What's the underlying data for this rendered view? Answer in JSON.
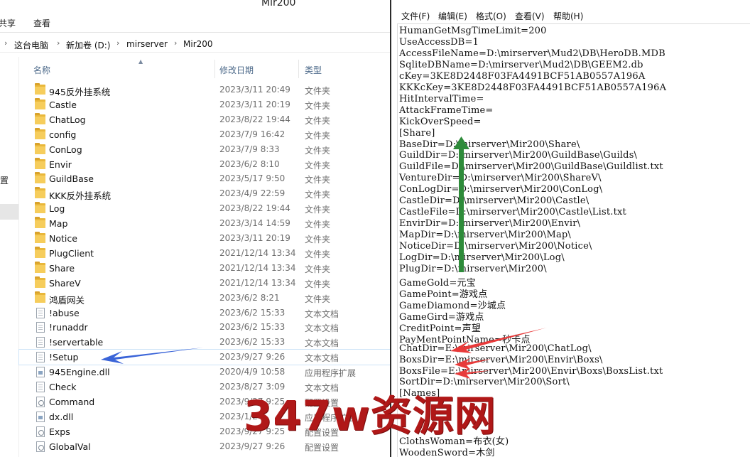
{
  "explorer": {
    "window_title": "Mir200",
    "ribbon": {
      "share_tab": "共享",
      "view_tab": "查看"
    },
    "breadcrumb": [
      "这台电脑",
      "新加卷 (D:)",
      "mirserver",
      "Mir200"
    ],
    "nav_label": "置",
    "columns": {
      "name": "名称",
      "date": "修改日期",
      "type": "类型"
    },
    "files": [
      {
        "name": "945反外挂系统",
        "date": "2023/3/11 20:49",
        "type": "文件夹",
        "icon": "folder-icon"
      },
      {
        "name": "Castle",
        "date": "2023/3/11 20:19",
        "type": "文件夹",
        "icon": "folder-icon"
      },
      {
        "name": "ChatLog",
        "date": "2023/8/22 19:44",
        "type": "文件夹",
        "icon": "folder-icon"
      },
      {
        "name": "config",
        "date": "2023/7/9 16:42",
        "type": "文件夹",
        "icon": "folder-icon"
      },
      {
        "name": "ConLog",
        "date": "2023/7/9 8:33",
        "type": "文件夹",
        "icon": "folder-icon"
      },
      {
        "name": "Envir",
        "date": "2023/6/2 8:10",
        "type": "文件夹",
        "icon": "folder-icon"
      },
      {
        "name": "GuildBase",
        "date": "2023/5/17 9:50",
        "type": "文件夹",
        "icon": "folder-icon"
      },
      {
        "name": "KKK反外挂系统",
        "date": "2023/4/9 22:59",
        "type": "文件夹",
        "icon": "folder-icon"
      },
      {
        "name": "Log",
        "date": "2023/8/22 19:44",
        "type": "文件夹",
        "icon": "folder-icon"
      },
      {
        "name": "Map",
        "date": "2023/3/14 14:59",
        "type": "文件夹",
        "icon": "folder-icon"
      },
      {
        "name": "Notice",
        "date": "2023/3/11 20:19",
        "type": "文件夹",
        "icon": "folder-icon"
      },
      {
        "name": "PlugClient",
        "date": "2021/12/14 13:34",
        "type": "文件夹",
        "icon": "folder-icon"
      },
      {
        "name": "Share",
        "date": "2021/12/14 13:34",
        "type": "文件夹",
        "icon": "folder-icon"
      },
      {
        "name": "ShareV",
        "date": "2021/12/14 13:34",
        "type": "文件夹",
        "icon": "folder-icon"
      },
      {
        "name": "鸿盾网关",
        "date": "2023/6/2 8:21",
        "type": "文件夹",
        "icon": "folder-icon"
      },
      {
        "name": "!abuse",
        "date": "2023/6/2 15:33",
        "type": "文本文档",
        "icon": "text-document-icon"
      },
      {
        "name": "!runaddr",
        "date": "2023/6/2 15:33",
        "type": "文本文档",
        "icon": "text-document-icon"
      },
      {
        "name": "!servertable",
        "date": "2023/6/2 15:33",
        "type": "文本文档",
        "icon": "text-document-icon"
      },
      {
        "name": "!Setup",
        "date": "2023/9/27 9:26",
        "type": "文本文档",
        "icon": "text-document-icon",
        "selected": true
      },
      {
        "name": "945Engine.dll",
        "date": "2020/4/9 10:58",
        "type": "应用程序扩展",
        "icon": "dll-icon"
      },
      {
        "name": "Check",
        "date": "2023/8/27 3:09",
        "type": "文本文档",
        "icon": "text-document-icon"
      },
      {
        "name": "Command",
        "date": "2023/9/27 9:25",
        "type": "配置设置",
        "icon": "config-file-icon"
      },
      {
        "name": "dx.dll",
        "date": "2023/1/2",
        "type": "应用程序扩展",
        "icon": "dll-icon"
      },
      {
        "name": "Exps",
        "date": "2023/9/27 9:25",
        "type": "配置设置",
        "icon": "config-file-icon"
      },
      {
        "name": "GlobalVal",
        "date": "2023/9/27 9:26",
        "type": "配置设置",
        "icon": "config-file-icon"
      }
    ]
  },
  "notepad": {
    "menu": [
      "文件(F)",
      "编辑(E)",
      "格式(O)",
      "查看(V)",
      "帮助(H)"
    ],
    "lines": [
      "HumanGetMsgTimeLimit=200",
      "UseAccessDB=1",
      "AccessFileName=D:\\mirserver\\Mud2\\DB\\HeroDB.MDB",
      "SqliteDBName=D:\\mirserver\\Mud2\\DB\\GEEM2.db",
      "cKey=3KE8D2448F03FA4491BCF51AB0557A196A",
      "KKKcKey=3KE8D2448F03FA4491BCF51AB0557A196A",
      "HitIntervalTime=",
      "AttackFrameTime=",
      "KickOverSpeed=",
      "[Share]",
      "BaseDir=D:\\mirserver\\Mir200\\Share\\",
      "GuildDir=D:\\mirserver\\Mir200\\GuildBase\\Guilds\\",
      "GuildFile=D:\\mirserver\\Mir200\\GuildBase\\Guildlist.txt",
      "VentureDir=D:\\mirserver\\Mir200\\ShareV\\",
      "ConLogDir=D:\\mirserver\\Mir200\\ConLog\\",
      "CastleDir=D:\\mirserver\\Mir200\\Castle\\",
      "CastleFile=D:\\mirserver\\Mir200\\Castle\\List.txt",
      "EnvirDir=D:\\mirserver\\Mir200\\Envir\\",
      "MapDir=D:\\mirserver\\Mir200\\Map\\",
      "NoticeDir=D:\\mirserver\\Mir200\\Notice\\",
      "LogDir=D:\\mirserver\\Mir200\\Log\\",
      "PlugDir=D:\\mirserver\\Mir200\\",
      "GameGold=元宝",
      "GamePoint=游戏点",
      "GameDiamond=沙城点",
      "GameGird=游戏点",
      "CreditPoint=声望",
      "PayMentPointName=秒卡点",
      "ChatDir=E:\\mirserver\\Mir200\\ChatLog\\",
      "BoxsDir=E:\\mirserver\\Mir200\\Envir\\Boxs\\",
      "BoxsFile=E:\\mirserver\\Mir200\\Envir\\Boxs\\BoxsList.txt",
      "SortDir=D:\\mirserver\\Mir200\\Sort\\",
      "[Names]",
      "",
      "",
      "",
      "ClothsWoman=布衣(女)",
      "WoodenSword=木剑"
    ]
  },
  "watermark": "347w资源网",
  "colors": {
    "arrow_blue": "#3a64d8",
    "arrow_green": "#2e8b3a",
    "arrow_red": "#e83a3a",
    "watermark": "#b01818"
  }
}
